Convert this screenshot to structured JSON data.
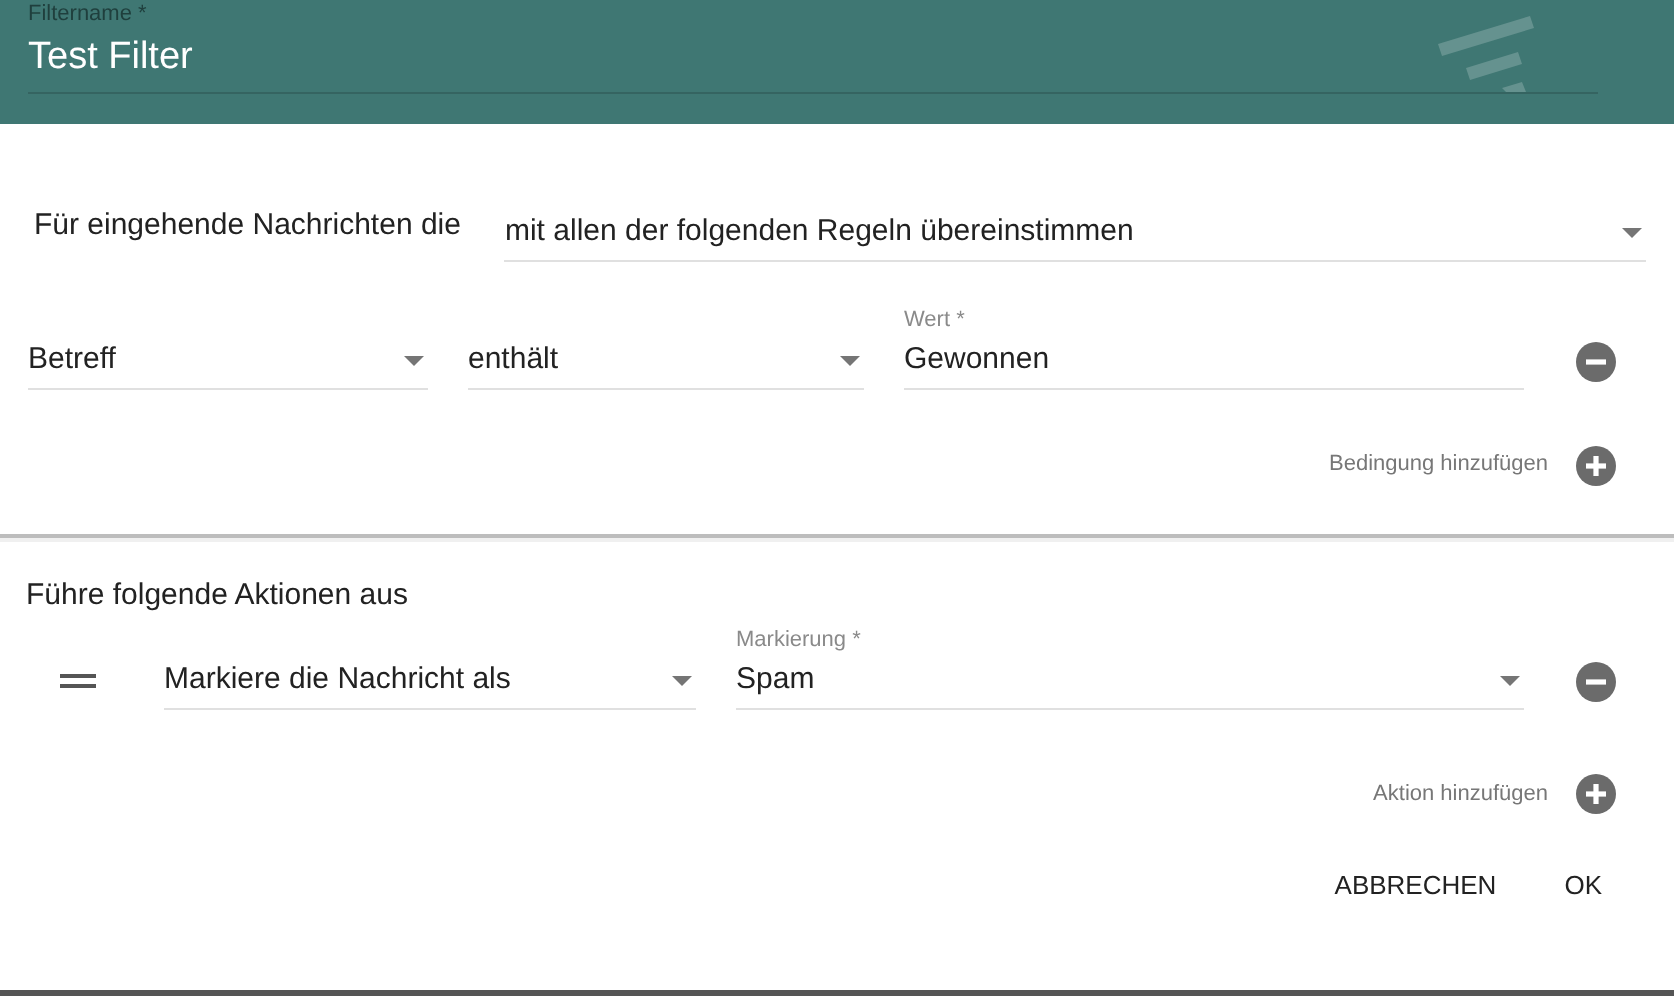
{
  "header": {
    "label": "Filtername *",
    "value": "Test Filter"
  },
  "match": {
    "label": "Für eingehende Nachrichten die",
    "value": "mit allen der folgenden Regeln übereinstimmen"
  },
  "conditions": [
    {
      "field": "Betreff",
      "operator": "enthält",
      "value_label": "Wert *",
      "value": "Gewonnen"
    }
  ],
  "add_condition": "Bedingung hinzufügen",
  "actions_title": "Führe folgende Aktionen aus",
  "actions": [
    {
      "action": "Markiere die Nachricht als",
      "value_label": "Markierung *",
      "value": "Spam"
    }
  ],
  "add_action": "Aktion hinzufügen",
  "buttons": [
    "ABBRECHEN",
    "OK"
  ]
}
